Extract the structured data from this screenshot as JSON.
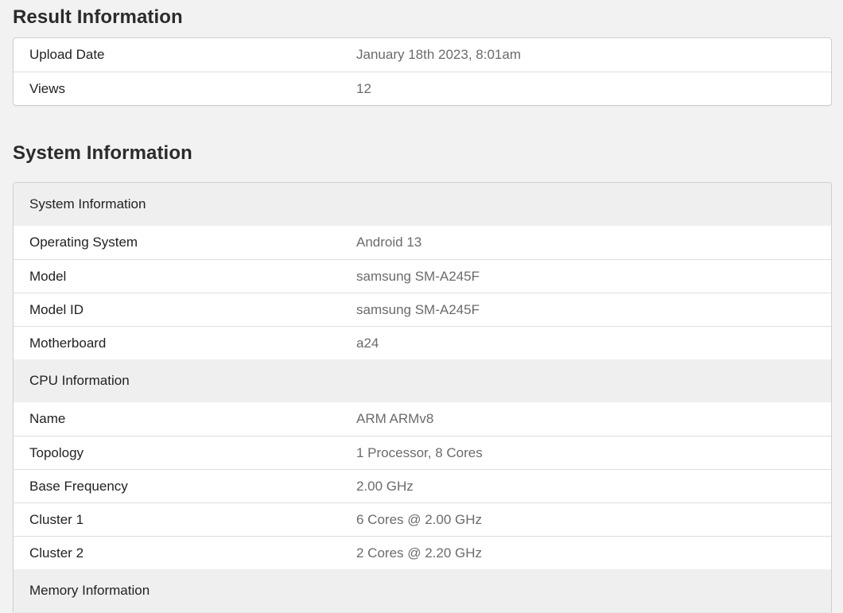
{
  "result_information": {
    "title": "Result Information",
    "rows": [
      {
        "label": "Upload Date",
        "value": "January 18th 2023, 8:01am"
      },
      {
        "label": "Views",
        "value": "12"
      }
    ]
  },
  "system_information": {
    "title": "System Information",
    "sections": [
      {
        "heading": "System Information",
        "rows": [
          {
            "label": "Operating System",
            "value": "Android 13"
          },
          {
            "label": "Model",
            "value": "samsung SM-A245F"
          },
          {
            "label": "Model ID",
            "value": "samsung SM-A245F"
          },
          {
            "label": "Motherboard",
            "value": "a24"
          }
        ]
      },
      {
        "heading": "CPU Information",
        "rows": [
          {
            "label": "Name",
            "value": "ARM ARMv8"
          },
          {
            "label": "Topology",
            "value": "1 Processor, 8 Cores"
          },
          {
            "label": "Base Frequency",
            "value": "2.00 GHz"
          },
          {
            "label": "Cluster 1",
            "value": "6 Cores @ 2.00 GHz"
          },
          {
            "label": "Cluster 2",
            "value": "2 Cores @ 2.20 GHz"
          }
        ]
      },
      {
        "heading": "Memory Information",
        "rows": []
      }
    ]
  }
}
